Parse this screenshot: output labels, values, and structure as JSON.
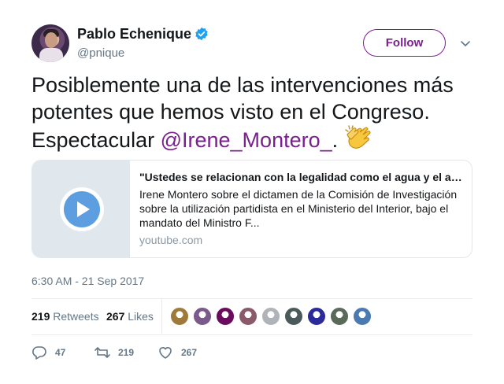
{
  "author": {
    "name": "Pablo Echenique",
    "handle": "@pnique",
    "verified": true
  },
  "follow_label": "Follow",
  "tweet": {
    "text_before": "Posiblemente una de las intervenciones más potentes que hemos visto en el Congreso. Espectacular ",
    "mention": "@Irene_Montero_",
    "text_after": ". ",
    "emoji": "clapping-hands"
  },
  "card": {
    "title": "\"Ustedes se relacionan con la legalidad como el agua y el aceite\"",
    "description": "Irene Montero sobre el dictamen de la Comisión de Investigación sobre la utilización partidista en el Ministerio del Interior, bajo el mandato del Ministro F...",
    "domain": "youtube.com"
  },
  "timestamp": "6:30 AM - 21 Sep 2017",
  "stats": {
    "retweets_count": "219",
    "retweets_label": "Retweets",
    "likes_count": "267",
    "likes_label": "Likes"
  },
  "liker_avatar_colors": [
    "#a07a3a",
    "#7a5a8a",
    "#6a0b5e",
    "#8a5a6a",
    "#b0b4b8",
    "#4a5a5a",
    "#2a2a9a",
    "#5a6a5a",
    "#4a7ab0"
  ],
  "actions": {
    "reply_count": "47",
    "retweet_count": "219",
    "like_count": "267"
  },
  "colors": {
    "accent": "#7b1e8f",
    "verified": "#1da1f2",
    "secondary_text": "#657786"
  }
}
